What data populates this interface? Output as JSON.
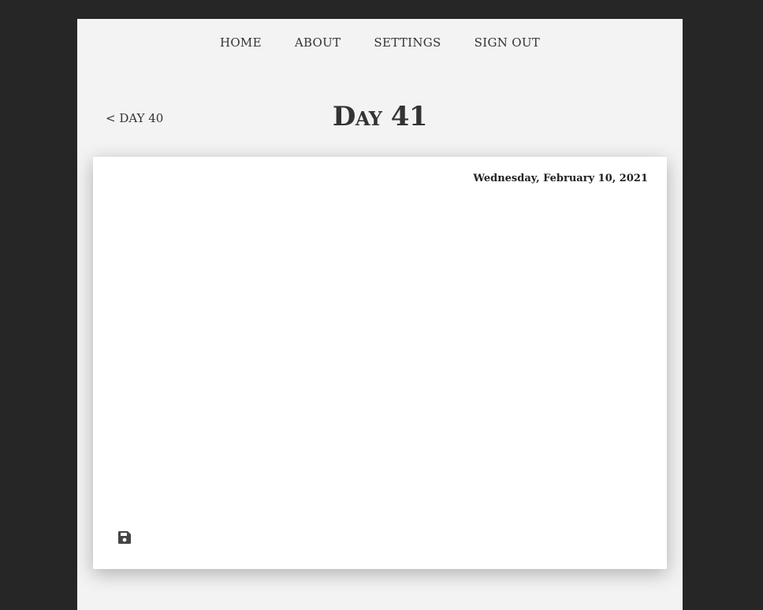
{
  "nav": {
    "items": [
      {
        "label": "HOME"
      },
      {
        "label": "ABOUT"
      },
      {
        "label": "SETTINGS"
      },
      {
        "label": "SIGN OUT"
      }
    ]
  },
  "header": {
    "prev_link": "< DAY 40",
    "title": "Day 41"
  },
  "entry": {
    "date": "Wednesday, February 10, 2021",
    "text": "",
    "save_icon": "floppy-disk-icon"
  },
  "colors": {
    "background": "#262626",
    "page": "#f3f3f3",
    "card": "#ffffff",
    "text": "#333333"
  }
}
